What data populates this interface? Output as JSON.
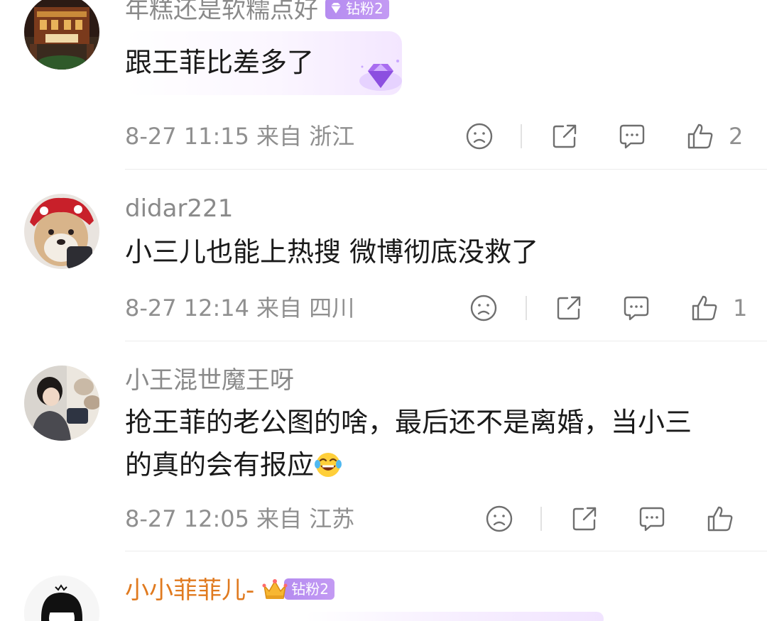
{
  "colors": {
    "text_primary": "#1a1a1a",
    "text_secondary": "#8f8f8f",
    "username_gold": "#e07a1f",
    "badge_purple": "#b58cf0",
    "divider": "#ececec"
  },
  "comments": [
    {
      "username": "年糕还是软糯点好",
      "badge": "钻粉2",
      "text": "跟王菲比差多了",
      "date": "8-27 11:15",
      "location": "来自 浙江",
      "likes": "2",
      "avatar_icon": "building-night-avatar"
    },
    {
      "username": "didar221",
      "text": "小三儿也能上热搜 微博彻底没救了",
      "date": "8-27 12:14",
      "location": "来自 四川",
      "likes": "1",
      "avatar_icon": "shiba-dog-avatar"
    },
    {
      "username": "小王混世魔王呀",
      "text_line1": "抢王菲的老公图的啥，最后还不是离婚，当小三",
      "text_line2": "的真的会有报应",
      "date": "8-27 12:05",
      "location": "来自 江苏",
      "likes": "",
      "avatar_icon": "girl-photo-avatar",
      "emoji_icon": "laughing-tears-emoji"
    },
    {
      "username": "小小菲菲儿-",
      "badge": "钻粉2",
      "avatar_icon": "cartoon-girl-avatar",
      "crown_icon": "crown-icon"
    }
  ],
  "icons": {
    "dislike": "frown-face-icon",
    "share": "share-icon",
    "reply": "comment-bubble-icon",
    "like": "thumbs-up-icon"
  }
}
